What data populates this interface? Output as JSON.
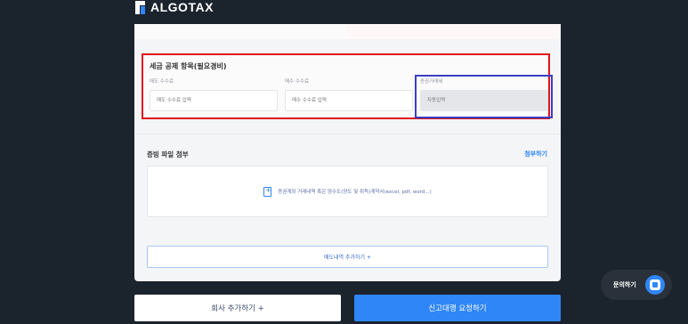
{
  "brand": {
    "name": "ALGOTAX"
  },
  "tax_deduction": {
    "title": "세금 공제 항목(필요경비)",
    "fields": [
      {
        "label": "매도 수수료",
        "placeholder": "매도 수수료 입력"
      },
      {
        "label": "매수 수수료",
        "placeholder": "매수 수수료 입력"
      },
      {
        "label": "증권거래세",
        "placeholder": "자동입력"
      }
    ]
  },
  "attachments": {
    "title": "증빙 파일 첨부",
    "attach_link": "첨부하기",
    "dropzone_text": "증권계좌 거래내역 혹은 양수도(양도 및 취득)계약서(excel, pdf, word...)"
  },
  "add_sale_label": "매도내역 추가하기 +",
  "buttons": {
    "add_company": "회사 추가하기 +",
    "submit": "신고대행 요청하기"
  },
  "inquiry": {
    "label": "문의하기"
  },
  "colors": {
    "accent": "#2f86f6",
    "highlight_red": "#e0141b",
    "highlight_blue": "#3a3fc4",
    "background": "#1b232d"
  }
}
